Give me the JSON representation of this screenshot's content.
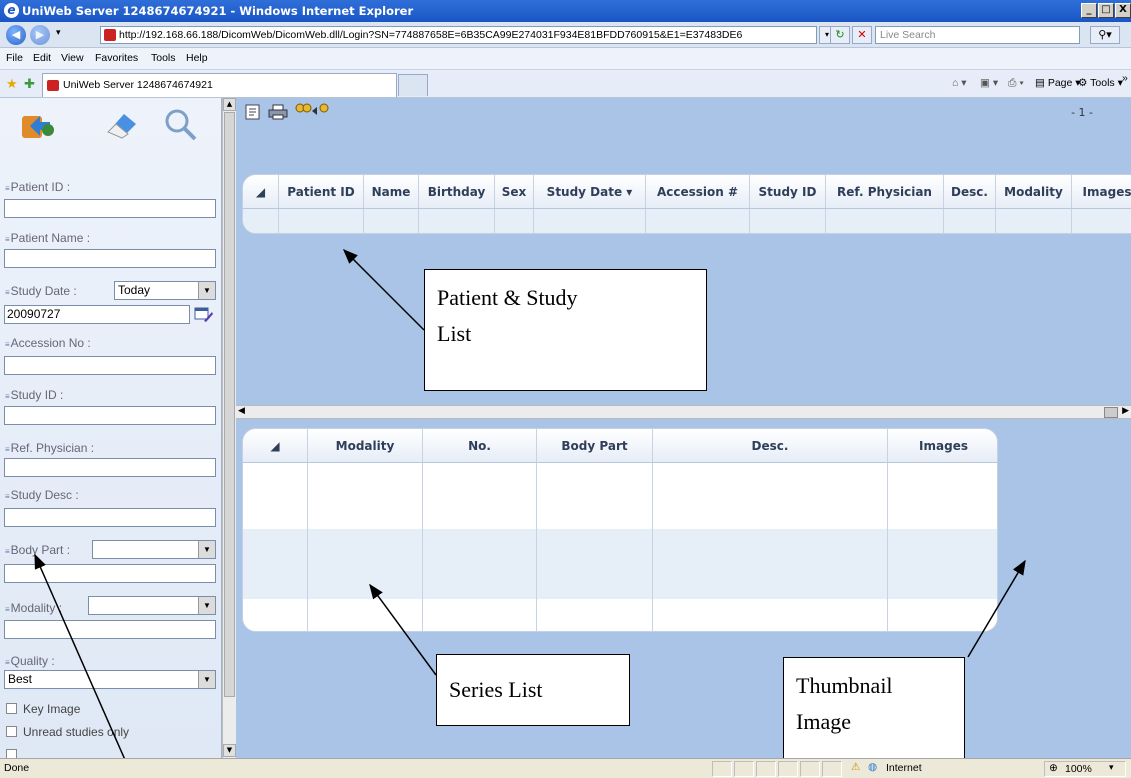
{
  "window": {
    "title": "UniWeb Server 1248674674921 - Windows Internet Explorer",
    "buttons": [
      "_",
      "□",
      "X"
    ]
  },
  "address": {
    "url": "http://192.168.66.188/DicomWeb/DicomWeb.dll/Login?SN=774887658E=6B35CA99E274031F934E81BFDD760915&E1=E37483DE6",
    "search_placeholder": "Live Search"
  },
  "menu": [
    "File",
    "Edit",
    "View",
    "Favorites",
    "Tools",
    "Help"
  ],
  "tab": {
    "title": "UniWeb Server 1248674674921",
    "tools": [
      "Page ▾",
      "Tools ▾",
      "»"
    ]
  },
  "left_panel": {
    "patient_id": {
      "label": "Patient ID :",
      "value": ""
    },
    "patient_name": {
      "label": "Patient Name :",
      "value": ""
    },
    "study_date": {
      "label": "Study Date :",
      "select": "Today",
      "value": "20090727"
    },
    "accession_no": {
      "label": "Accession No :",
      "value": ""
    },
    "study_id": {
      "label": "Study ID :",
      "value": ""
    },
    "ref_physician": {
      "label": "Ref. Physician :",
      "value": ""
    },
    "study_desc": {
      "label": "Study Desc :",
      "value": ""
    },
    "body_part": {
      "label": "Body Part :",
      "select": "",
      "value": ""
    },
    "modality": {
      "label": "Modality :",
      "select": "",
      "value": ""
    },
    "quality": {
      "label": "Quality :",
      "select": "Best"
    },
    "checks": [
      "Key Image",
      "Unread studies only"
    ]
  },
  "main": {
    "page_indicator": "- 1 -",
    "study_columns": [
      "Patient ID",
      "Name",
      "Birthday",
      "Sex",
      "Study Date ▾",
      "Accession #",
      "Study ID",
      "Ref. Physician",
      "Desc.",
      "Modality",
      "Images"
    ],
    "series_columns": [
      "Modality",
      "No.",
      "Body Part",
      "Desc.",
      "Images"
    ]
  },
  "annotations": {
    "patient_study_list": [
      "Patient & Study",
      "List"
    ],
    "series_list": "Series List",
    "thumbnail_image": [
      "Thumbnail",
      "Image"
    ]
  },
  "status": {
    "left": "Done",
    "zone": "Internet",
    "zoom": "100%"
  }
}
